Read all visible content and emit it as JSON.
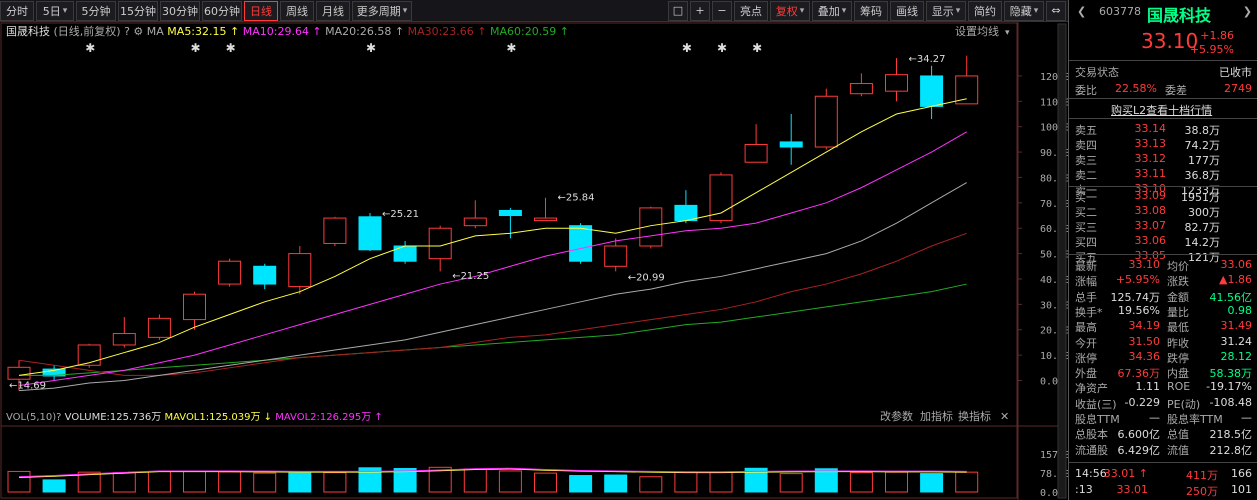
{
  "toolbar": {
    "left": [
      {
        "label": "分时",
        "kind": "plain"
      },
      {
        "label": "5日",
        "kind": "dd"
      },
      {
        "label": "5分钟",
        "kind": "plain"
      },
      {
        "label": "15分钟",
        "kind": "plain"
      },
      {
        "label": "30分钟",
        "kind": "plain"
      },
      {
        "label": "60分钟",
        "kind": "plain"
      },
      {
        "label": "日线",
        "kind": "active"
      },
      {
        "label": "周线",
        "kind": "plain"
      },
      {
        "label": "月线",
        "kind": "plain"
      },
      {
        "label": "更多周期",
        "kind": "dd"
      }
    ],
    "right": [
      {
        "label": "□",
        "kind": "plain",
        "name": "frame-icon"
      },
      {
        "label": "+",
        "kind": "plain",
        "name": "zoom-in-icon"
      },
      {
        "label": "−",
        "kind": "plain",
        "name": "zoom-out-icon"
      },
      {
        "label": "亮点",
        "kind": "plain"
      },
      {
        "label": "复权",
        "kind": "red-dd"
      },
      {
        "label": "叠加",
        "kind": "dd"
      },
      {
        "label": "筹码",
        "kind": "plain"
      },
      {
        "label": "画线",
        "kind": "plain"
      },
      {
        "label": "显示",
        "kind": "dd"
      },
      {
        "label": "简约",
        "kind": "plain"
      },
      {
        "label": "隐藏",
        "kind": "dd"
      },
      {
        "label": "⇔",
        "kind": "plain",
        "name": "expand-icon"
      }
    ]
  },
  "chart_header": {
    "stock_name": "国晟科技",
    "mode": "(日线,前复权)",
    "help": "?",
    "ma_label": "MA",
    "ma5": "MA5:32.15",
    "ma10": "MA10:29.64",
    "ma20": "MA20:26.58",
    "ma30": "MA30:23.66",
    "ma60": "MA60:20.59",
    "settings": "设置均线"
  },
  "volume_header": {
    "vol": "VOL(5,10)",
    "volume": "VOLUME:125.736万",
    "mavol1": "MAVOL1:125.039万",
    "mavol2": "MAVOL2:126.295万",
    "modify": "改参数",
    "add": "加指标",
    "swap": "换指标",
    "close": "✕"
  },
  "chart_data": {
    "type": "candlestick",
    "price_axis_ticks": [
      "120.00",
      "110.00",
      "100.00",
      "90.00",
      "80.00",
      "70.00",
      "60.00",
      "50.00",
      "40.00",
      "30.00",
      "20.00",
      "10.00",
      "0.00"
    ],
    "volume_axis_ticks": [
      "157.00",
      "78.60",
      "0.00"
    ],
    "candles": [
      {
        "o": 0.5,
        "c": 5.2,
        "h": 8,
        "l": -4
      },
      {
        "o": 4.5,
        "c": 1.8,
        "h": 6,
        "l": 0
      },
      {
        "o": 6,
        "c": 14,
        "h": 14.5,
        "l": 5
      },
      {
        "o": 14,
        "c": 18.5,
        "h": 25,
        "l": 13
      },
      {
        "o": 17,
        "c": 24.5,
        "h": 26,
        "l": 16
      },
      {
        "o": 24,
        "c": 34,
        "h": 35,
        "l": 20
      },
      {
        "o": 38,
        "c": 47,
        "h": 48,
        "l": 37
      },
      {
        "o": 45,
        "c": 38,
        "h": 46,
        "l": 36
      },
      {
        "o": 37,
        "c": 50,
        "h": 53,
        "l": 34
      },
      {
        "o": 54,
        "c": 64,
        "h": 64.5,
        "l": 53
      },
      {
        "o": 64.5,
        "c": 51.5,
        "h": 66,
        "l": 51
      },
      {
        "o": 53,
        "c": 47,
        "h": 55,
        "l": 46
      },
      {
        "o": 48,
        "c": 60,
        "h": 61,
        "l": 43
      },
      {
        "o": 61,
        "c": 64,
        "h": 71,
        "l": 60
      },
      {
        "o": 67,
        "c": 65,
        "h": 68,
        "l": 56
      },
      {
        "o": 63,
        "c": 64,
        "h": 72,
        "l": 63
      },
      {
        "o": 61,
        "c": 47,
        "h": 62,
        "l": 46
      },
      {
        "o": 45,
        "c": 53,
        "h": 56,
        "l": 43
      },
      {
        "o": 53,
        "c": 68,
        "h": 68.5,
        "l": 52
      },
      {
        "o": 69,
        "c": 63,
        "h": 75,
        "l": 62
      },
      {
        "o": 63,
        "c": 81,
        "h": 82,
        "l": 62
      },
      {
        "o": 86,
        "c": 93,
        "h": 101,
        "l": 86
      },
      {
        "o": 94,
        "c": 92,
        "h": 105,
        "l": 85
      },
      {
        "o": 92,
        "c": 112,
        "h": 115,
        "l": 91
      },
      {
        "o": 113,
        "c": 117,
        "h": 121,
        "l": 112
      },
      {
        "o": 114,
        "c": 120.5,
        "h": 127,
        "l": 110
      },
      {
        "o": 120,
        "c": 108,
        "h": 124,
        "l": 103
      },
      {
        "o": 109,
        "c": 120,
        "h": 128,
        "l": 109
      }
    ],
    "ma5": [
      2,
      4,
      7,
      11,
      15,
      21,
      26,
      31,
      35,
      41,
      48,
      53,
      53,
      57,
      58,
      60,
      60,
      58,
      61,
      63,
      66,
      74,
      82,
      90,
      98,
      105,
      108,
      111
    ],
    "ma10": [
      -2,
      0,
      2,
      4,
      7,
      10,
      14,
      18,
      22,
      26,
      30,
      34,
      38,
      41,
      45,
      49,
      52,
      55,
      57,
      59,
      60,
      62,
      66,
      70,
      76,
      83,
      90,
      98
    ],
    "ma20": [
      -4,
      -3,
      -1,
      0,
      2,
      4,
      6,
      8,
      10,
      12,
      14,
      16,
      19,
      22,
      25,
      28,
      31,
      34,
      36,
      39,
      41,
      44,
      47,
      50,
      55,
      62,
      70,
      78
    ],
    "ma30": [
      8,
      6,
      4,
      2,
      2,
      3,
      5,
      7,
      9,
      10,
      11,
      12,
      13,
      15,
      17,
      18,
      20,
      22,
      24,
      26,
      28,
      31,
      35,
      38,
      42,
      47,
      53,
      58
    ],
    "ma60": [
      2,
      2,
      3,
      4,
      5,
      6,
      7,
      8,
      9,
      10,
      11,
      12,
      13,
      14,
      15,
      16,
      17,
      18,
      20,
      22,
      23,
      25,
      27,
      29,
      31,
      33,
      35,
      38
    ],
    "volumes": [
      [
        85,
        1
      ],
      [
        50,
        0
      ],
      [
        82,
        1
      ],
      [
        80,
        1
      ],
      [
        85,
        1
      ],
      [
        85,
        1
      ],
      [
        83,
        1
      ],
      [
        78,
        1
      ],
      [
        78,
        0
      ],
      [
        80,
        1
      ],
      [
        100,
        0
      ],
      [
        97,
        0
      ],
      [
        102,
        1
      ],
      [
        95,
        1
      ],
      [
        87,
        1
      ],
      [
        78,
        1
      ],
      [
        68,
        0
      ],
      [
        70,
        0
      ],
      [
        63,
        1
      ],
      [
        83,
        1
      ],
      [
        82,
        1
      ],
      [
        98,
        0
      ],
      [
        76,
        1
      ],
      [
        96,
        0
      ],
      [
        80,
        1
      ],
      [
        82,
        1
      ],
      [
        76,
        0
      ],
      [
        82,
        1
      ]
    ],
    "mavol": [
      60,
      65,
      72,
      78,
      84,
      84,
      84,
      83,
      82,
      82,
      82,
      84,
      88,
      93,
      95,
      90,
      86,
      84,
      82,
      80,
      80,
      82,
      83,
      84,
      84,
      83,
      83,
      82
    ],
    "annotations": [
      {
        "text": "14.69",
        "candle": 0,
        "price": -1.5,
        "side": "right"
      },
      {
        "text": "25.21",
        "candle": 10,
        "price": 66,
        "side": "right"
      },
      {
        "text": "21.25",
        "candle": 12,
        "price": 41.5,
        "side": "right"
      },
      {
        "text": "25.84",
        "candle": 15,
        "price": 72.5,
        "side": "right"
      },
      {
        "text": "20.99",
        "candle": 17,
        "price": 41,
        "side": "right"
      },
      {
        "text": "34.27",
        "candle": 25,
        "price": 127,
        "side": "right"
      }
    ]
  },
  "quote": {
    "code": "603778",
    "name": "国晟科技",
    "price": "33.10",
    "change": "+1.86",
    "change_pct": "+5.95%",
    "status_label": "交易状态",
    "status_value": "已收市",
    "weibi_label": "委比",
    "weibi_value": "22.58%",
    "weicha_label": "委差",
    "weicha_value": "2749",
    "l2_link": "购买L2查看十档行情",
    "asks": [
      {
        "label": "卖五",
        "price": "33.14",
        "vol": "38.8万"
      },
      {
        "label": "卖四",
        "price": "33.13",
        "vol": "74.2万"
      },
      {
        "label": "卖三",
        "price": "33.12",
        "vol": "177万"
      },
      {
        "label": "卖二",
        "price": "33.11",
        "vol": "36.8万"
      },
      {
        "label": "卖一",
        "price": "33.10",
        "vol": "1233万"
      }
    ],
    "bids": [
      {
        "label": "买一",
        "price": "33.09",
        "vol": "1951万"
      },
      {
        "label": "买二",
        "price": "33.08",
        "vol": "300万"
      },
      {
        "label": "买三",
        "price": "33.07",
        "vol": "82.7万"
      },
      {
        "label": "买四",
        "price": "33.06",
        "vol": "14.2万"
      },
      {
        "label": "买五",
        "price": "33.05",
        "vol": "121万"
      }
    ],
    "stats": [
      [
        {
          "l": "最新",
          "v": "33.10",
          "c": "up"
        },
        {
          "l": "均价",
          "v": "33.06",
          "c": "up"
        }
      ],
      [
        {
          "l": "涨幅",
          "v": "+5.95%",
          "c": "up"
        },
        {
          "l": "涨跌",
          "v": "▲1.86",
          "c": "up"
        }
      ],
      [
        {
          "l": "总手",
          "v": "125.74万",
          "c": "wt"
        },
        {
          "l": "金额",
          "v": "41.56亿",
          "c": "dn"
        }
      ],
      [
        {
          "l": "换手*",
          "v": "19.56%",
          "c": "wt"
        },
        {
          "l": "量比",
          "v": "0.98",
          "c": "dn"
        }
      ],
      [
        {
          "l": "最高",
          "v": "34.19",
          "c": "up"
        },
        {
          "l": "最低",
          "v": "31.49",
          "c": "up"
        }
      ],
      [
        {
          "l": "今开",
          "v": "31.50",
          "c": "up"
        },
        {
          "l": "昨收",
          "v": "31.24",
          "c": "wt"
        }
      ],
      [
        {
          "l": "涨停",
          "v": "34.36",
          "c": "up"
        },
        {
          "l": "跌停",
          "v": "28.12",
          "c": "dn"
        }
      ],
      [
        {
          "l": "外盘",
          "v": "67.36万",
          "c": "up"
        },
        {
          "l": "内盘",
          "v": "58.38万",
          "c": "dn"
        }
      ],
      [
        {
          "l": "净资产",
          "v": "1.11",
          "c": "wt"
        },
        {
          "l": "ROE",
          "v": "-19.17%",
          "c": "wt"
        }
      ],
      [
        {
          "l": "收益(三)",
          "v": "-0.229",
          "c": "wt"
        },
        {
          "l": "PE(动)",
          "v": "-108.48",
          "c": "wt"
        }
      ],
      [
        {
          "l": "股息TTM",
          "v": "—",
          "c": "wt"
        },
        {
          "l": "股息率TTM",
          "v": "—",
          "c": "wt"
        }
      ],
      [
        {
          "l": "总股本",
          "v": "6.600亿",
          "c": "wt"
        },
        {
          "l": "总值",
          "v": "218.5亿",
          "c": "wt"
        }
      ],
      [
        {
          "l": "流通股",
          "v": "6.429亿",
          "c": "wt"
        },
        {
          "l": "流值",
          "v": "212.8亿",
          "c": "wt"
        }
      ]
    ],
    "ticks": [
      {
        "time": "14:56",
        "price": "33.01",
        "dir": "↑",
        "vol": "411万",
        "num": "166"
      },
      {
        "time": ":13",
        "price": "33.01",
        "dir": "",
        "vol": "250万",
        "num": "101"
      }
    ]
  },
  "colors": {
    "up": "#ff3b3b",
    "down": "#00e5ff",
    "ma5": "#ffff44",
    "ma10": "#ff33ff",
    "ma20": "#aaaaaa",
    "ma30": "#aa2222",
    "ma60": "#22aa22"
  }
}
